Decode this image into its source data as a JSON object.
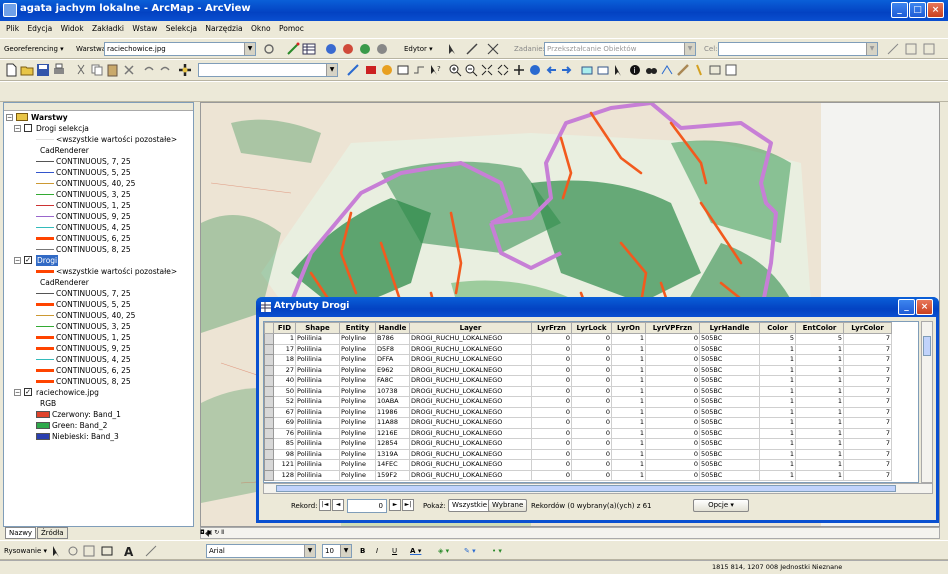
{
  "window": {
    "title": "agata jachym lokalne - ArcMap - ArcView"
  },
  "menu": [
    "Plik",
    "Edycja",
    "Widok",
    "Zakładki",
    "Wstaw",
    "Selekcja",
    "Narzędzia",
    "Okno",
    "Pomoc"
  ],
  "georef_bar": {
    "label": "Georeferencing ▾",
    "layer_label": "Warstwa:",
    "layer_value": "raciechowice.jpg",
    "right_label": "Cel:"
  },
  "editor_bar": {
    "label": "Edytor ▾",
    "task_label": "Zadanie:",
    "task_value": "Przekształcanie Obiektów"
  },
  "standard_bar": {
    "scale_value": ""
  },
  "toc": {
    "root": "Warstwy",
    "groups": [
      {
        "name": "Drogi selekcja",
        "checked": false,
        "highlight": false,
        "items": [
          {
            "label": "<wszystkie wartości pozostałe>",
            "color": "#e0e0e0",
            "thick": false
          },
          {
            "label": "CadRenderer",
            "color": "",
            "thick": false
          },
          {
            "label": "CONTINUOUS, 7, 25",
            "color": "#555555",
            "thick": false
          },
          {
            "label": "CONTINUOUS, 5, 25",
            "color": "#3355cc",
            "thick": false
          },
          {
            "label": "CONTINUOUS, 40, 25",
            "color": "#cc9933",
            "thick": false
          },
          {
            "label": "CONTINUOUS, 3, 25",
            "color": "#33aa33",
            "thick": false
          },
          {
            "label": "CONTINUOUS, 1, 25",
            "color": "#cc3333",
            "thick": false
          },
          {
            "label": "CONTINUOUS, 9, 25",
            "color": "#9966cc",
            "thick": false
          },
          {
            "label": "CONTINUOUS, 4, 25",
            "color": "#33bbbb",
            "thick": false
          },
          {
            "label": "CONTINUOUS, 6, 25",
            "color": "#ff4400",
            "thick": true
          },
          {
            "label": "CONTINUOUS, 8, 25",
            "color": "#777777",
            "thick": false
          }
        ]
      },
      {
        "name": "Drogi",
        "checked": true,
        "highlight": true,
        "items": [
          {
            "label": "<wszystkie wartości pozostałe>",
            "color": "#ff4400",
            "thick": true
          },
          {
            "label": "CadRenderer",
            "color": "",
            "thick": false
          },
          {
            "label": "CONTINUOUS, 7, 25",
            "color": "#555555",
            "thick": false
          },
          {
            "label": "CONTINUOUS, 5, 25",
            "color": "#ff4400",
            "thick": true
          },
          {
            "label": "CONTINUOUS, 40, 25",
            "color": "#cc9933",
            "thick": false
          },
          {
            "label": "CONTINUOUS, 3, 25",
            "color": "#33aa33",
            "thick": false
          },
          {
            "label": "CONTINUOUS, 1, 25",
            "color": "#ff4400",
            "thick": true
          },
          {
            "label": "CONTINUOUS, 9, 25",
            "color": "#ff4400",
            "thick": true
          },
          {
            "label": "CONTINUOUS, 4, 25",
            "color": "#33bbbb",
            "thick": false
          },
          {
            "label": "CONTINUOUS, 6, 25",
            "color": "#ff4400",
            "thick": true
          },
          {
            "label": "CONTINUOUS, 8, 25",
            "color": "#ff4400",
            "thick": true
          }
        ]
      }
    ],
    "raster": {
      "name": "raciechowice.jpg",
      "sublabel": "RGB",
      "bands": [
        {
          "label": "Czerwony: Band_1",
          "color": "#e0432b"
        },
        {
          "label": "Green: Band_2",
          "color": "#2fa84b"
        },
        {
          "label": "Niebieski: Band_3",
          "color": "#2a3fb0"
        }
      ]
    },
    "tabs": [
      "Nazwy",
      "Źródła"
    ]
  },
  "attr_table": {
    "title": "Atrybuty Drogi",
    "columns": [
      "FID",
      "Shape",
      "Entity",
      "Handle",
      "Layer",
      "LyrFrzn",
      "LyrLock",
      "LyrOn",
      "LyrVPFrzn",
      "LyrHandle",
      "Color",
      "EntColor",
      "LyrColor"
    ],
    "rows": [
      [
        "1",
        "Polilinia",
        "Polyline",
        "B786",
        "DROGI_RUCHU_LOKALNEGO",
        "0",
        "0",
        "1",
        "0",
        "505BC",
        "5",
        "5",
        "7"
      ],
      [
        "17",
        "Polilinia",
        "Polyline",
        "D5F8",
        "DROGI_RUCHU_LOKALNEGO",
        "0",
        "0",
        "1",
        "0",
        "505BC",
        "1",
        "1",
        "7"
      ],
      [
        "18",
        "Polilinia",
        "Polyline",
        "DFFA",
        "DROGI_RUCHU_LOKALNEGO",
        "0",
        "0",
        "1",
        "0",
        "505BC",
        "1",
        "1",
        "7"
      ],
      [
        "27",
        "Polilinia",
        "Polyline",
        "E962",
        "DROGI_RUCHU_LOKALNEGO",
        "0",
        "0",
        "1",
        "0",
        "505BC",
        "1",
        "1",
        "7"
      ],
      [
        "40",
        "Polilinia",
        "Polyline",
        "FA8C",
        "DROGI_RUCHU_LOKALNEGO",
        "0",
        "0",
        "1",
        "0",
        "505BC",
        "1",
        "1",
        "7"
      ],
      [
        "50",
        "Polilinia",
        "Polyline",
        "10738",
        "DROGI_RUCHU_LOKALNEGO",
        "0",
        "0",
        "1",
        "0",
        "505BC",
        "1",
        "1",
        "7"
      ],
      [
        "52",
        "Polilinia",
        "Polyline",
        "10ABA",
        "DROGI_RUCHU_LOKALNEGO",
        "0",
        "0",
        "1",
        "0",
        "505BC",
        "1",
        "1",
        "7"
      ],
      [
        "67",
        "Polilinia",
        "Polyline",
        "11986",
        "DROGI_RUCHU_LOKALNEGO",
        "0",
        "0",
        "1",
        "0",
        "505BC",
        "1",
        "1",
        "7"
      ],
      [
        "69",
        "Polilinia",
        "Polyline",
        "11A88",
        "DROGI_RUCHU_LOKALNEGO",
        "0",
        "0",
        "1",
        "0",
        "505BC",
        "1",
        "1",
        "7"
      ],
      [
        "76",
        "Polilinia",
        "Polyline",
        "1216E",
        "DROGI_RUCHU_LOKALNEGO",
        "0",
        "0",
        "1",
        "0",
        "505BC",
        "1",
        "1",
        "7"
      ],
      [
        "85",
        "Polilinia",
        "Polyline",
        "12854",
        "DROGI_RUCHU_LOKALNEGO",
        "0",
        "0",
        "1",
        "0",
        "505BC",
        "1",
        "1",
        "7"
      ],
      [
        "98",
        "Polilinia",
        "Polyline",
        "1319A",
        "DROGI_RUCHU_LOKALNEGO",
        "0",
        "0",
        "1",
        "0",
        "505BC",
        "1",
        "1",
        "7"
      ],
      [
        "121",
        "Polilinia",
        "Polyline",
        "14FEC",
        "DROGI_RUCHU_LOKALNEGO",
        "0",
        "0",
        "1",
        "0",
        "505BC",
        "1",
        "1",
        "7"
      ],
      [
        "128",
        "Polilinia",
        "Polyline",
        "159F2",
        "DROGI_RUCHU_LOKALNEGO",
        "0",
        "0",
        "1",
        "0",
        "505BC",
        "1",
        "1",
        "7"
      ]
    ],
    "nav": {
      "record_label": "Rekord:",
      "record_value": "0",
      "show_label": "Pokaż:",
      "all_label": "Wszystkie",
      "selected_label": "Wybrane",
      "records_text": "Rekordów (0 wybrany(a)(ych) z 61",
      "options_label": "Opcje ▾"
    }
  },
  "drawing_bar": {
    "draw_label": "Rysowanie ▾",
    "font": "Arial",
    "size": "10"
  },
  "status": {
    "coords": "1815 814, 1207 008 Jednostki Nieznane"
  },
  "map_colors": {
    "boundary": "#c77fd6",
    "roads": "#f25a1e",
    "forest": "#2e8b4a",
    "light_forest": "#8fc97a",
    "paper": "#f1efe6"
  }
}
